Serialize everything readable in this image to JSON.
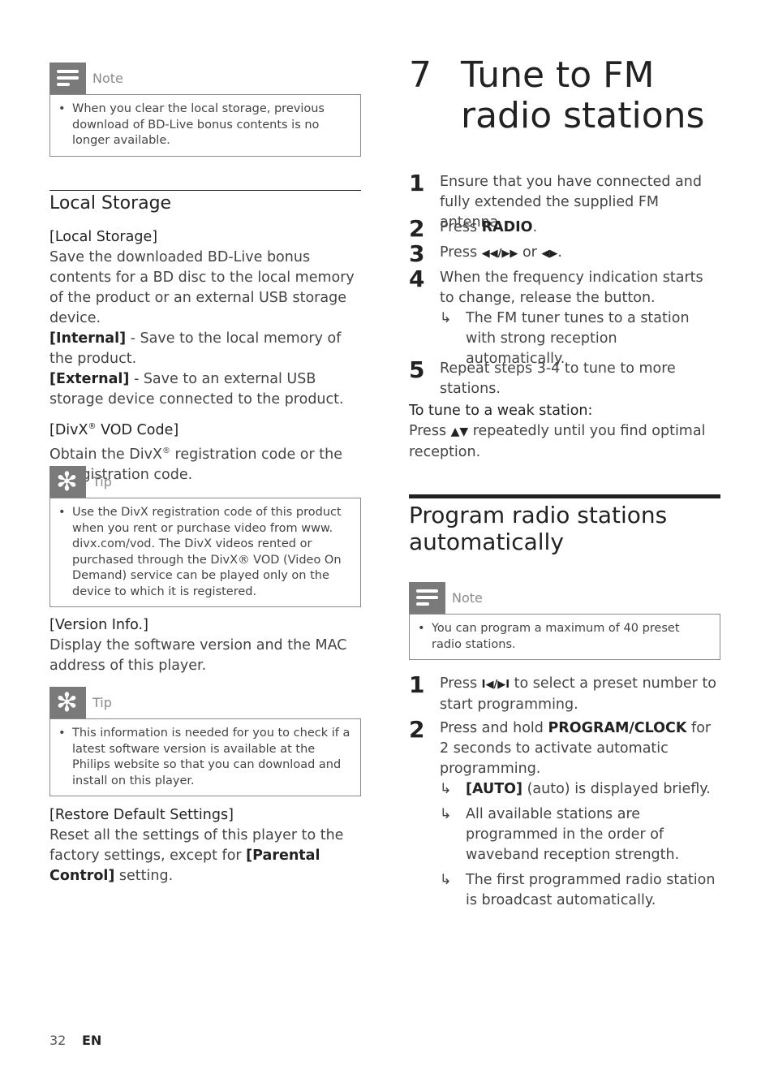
{
  "left": {
    "note1": {
      "label": "Note",
      "icon": "note-icon",
      "text": "When you clear the local storage, previous download of BD-Live bonus contents is no longer available."
    },
    "section_title": "Local Storage",
    "local_storage": {
      "heading": "[Local Storage]",
      "desc": "Save the downloaded BD-Live bonus contents for a BD disc to the local memory of the product or an external USB storage device.",
      "internal_label": "[Internal]",
      "internal_desc": " - Save to the local memory of the product.",
      "external_label": "[External]",
      "external_desc": " - Save to an external USB storage device connected to the product."
    },
    "divx": {
      "heading_pre": "[DivX",
      "heading_reg": "®",
      "heading_post": " VOD Code]",
      "desc_pre": "Obtain the DivX",
      "desc_reg": "®",
      "desc_post": " registration code or the deregistration code."
    },
    "tip1": {
      "label": "Tip",
      "icon": "tip-icon",
      "text": "Use the DivX registration code of this product when you rent or purchase video from www. divx.com/vod. The DivX videos rented or purchased through the DivX® VOD (Video On Demand) service can be played only on the device to which it is registered."
    },
    "version": {
      "heading": "[Version Info.]",
      "desc": "Display the software version and the MAC address of this player."
    },
    "tip2": {
      "label": "Tip",
      "icon": "tip-icon",
      "text": "This information is needed for you to check if a latest software version is available at the Philips website so that you can download and install on this player."
    },
    "restore": {
      "heading": "[Restore Default Settings]",
      "desc_pre": "Reset all the settings of this player to the factory settings, except for ",
      "desc_bold": "[Parental Control]",
      "desc_post": " setting."
    }
  },
  "right": {
    "chapter_number": "7",
    "chapter_title_line1": "Tune to FM",
    "chapter_title_line2": "radio stations",
    "steps": [
      {
        "num": "1",
        "text": "Ensure that you have connected and fully extended the supplied FM antenna."
      },
      {
        "num": "2",
        "pre": "Press ",
        "bold": "RADIO",
        "post": "."
      },
      {
        "num": "3",
        "pre": "Press ",
        "sym1": "◀◀/▶▶",
        "mid": " or ",
        "sym2": "◀▶",
        "post": "."
      },
      {
        "num": "4",
        "text": "When the frequency indication starts to change, release the button.",
        "result": "The FM tuner tunes to a station with strong reception automatically."
      },
      {
        "num": "5",
        "text": "Repeat steps 3-4 to tune to more stations."
      }
    ],
    "weak_heading": "To tune to a weak station:",
    "weak_pre": "Press ",
    "weak_sym": "▲▼",
    "weak_post": " repeatedly until you find optimal reception.",
    "section_title": "Program radio stations automatically",
    "note": {
      "label": "Note",
      "icon": "note-icon",
      "text": "You can program a maximum of 40 preset radio stations."
    },
    "prog_steps": [
      {
        "num": "1",
        "pre": "Press ",
        "sym": "I◀/▶I",
        "post": " to select a preset number to start programming."
      },
      {
        "num": "2",
        "pre": "Press and hold ",
        "bold": "PROGRAM/CLOCK",
        "post": " for 2 seconds to activate automatic programming.",
        "results": [
          {
            "bold": "[AUTO]",
            "text": " (auto) is displayed briefly."
          },
          {
            "text": "All available stations are programmed in the order of waveband reception strength."
          },
          {
            "text": "The first programmed radio station is broadcast automatically."
          }
        ]
      }
    ],
    "result_arrow": "↳"
  },
  "footer": {
    "page_number": "32",
    "language": "EN"
  }
}
